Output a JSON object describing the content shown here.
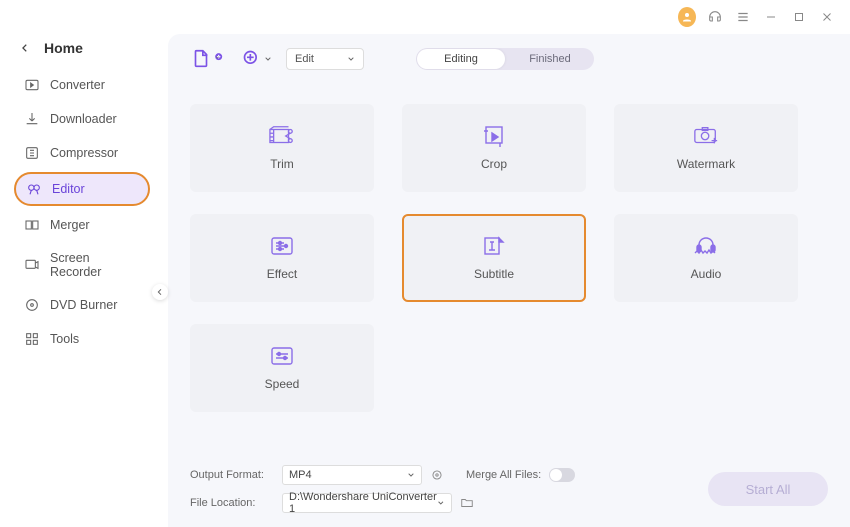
{
  "titlebar": {
    "icons": [
      "user",
      "support",
      "menu",
      "minimize",
      "maximize",
      "close"
    ]
  },
  "home": {
    "label": "Home"
  },
  "sidebar": {
    "items": [
      {
        "label": "Converter",
        "icon": "converter"
      },
      {
        "label": "Downloader",
        "icon": "downloader"
      },
      {
        "label": "Compressor",
        "icon": "compressor"
      },
      {
        "label": "Editor",
        "icon": "editor",
        "selected": true
      },
      {
        "label": "Merger",
        "icon": "merger"
      },
      {
        "label": "Screen Recorder",
        "icon": "screenrecorder"
      },
      {
        "label": "DVD Burner",
        "icon": "dvdburner"
      },
      {
        "label": "Tools",
        "icon": "tools"
      }
    ]
  },
  "toolbar": {
    "edit_select": "Edit",
    "seg_editing": "Editing",
    "seg_finished": "Finished"
  },
  "cards": [
    {
      "label": "Trim",
      "icon": "trim"
    },
    {
      "label": "Crop",
      "icon": "crop"
    },
    {
      "label": "Watermark",
      "icon": "watermark"
    },
    {
      "label": "Effect",
      "icon": "effect"
    },
    {
      "label": "Subtitle",
      "icon": "subtitle",
      "highlighted": true
    },
    {
      "label": "Audio",
      "icon": "audio"
    },
    {
      "label": "Speed",
      "icon": "speed"
    }
  ],
  "footer": {
    "output_format_label": "Output Format:",
    "output_format_value": "MP4",
    "file_location_label": "File Location:",
    "file_location_value": "D:\\Wondershare UniConverter 1",
    "merge_label": "Merge All Files:",
    "start_label": "Start All"
  }
}
